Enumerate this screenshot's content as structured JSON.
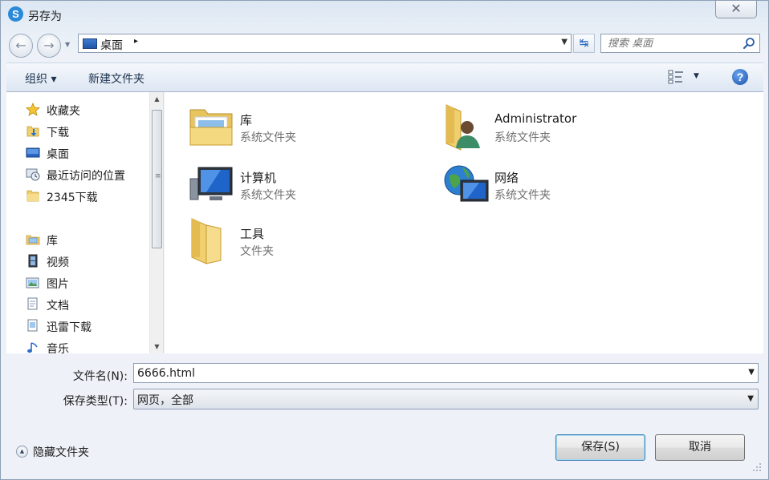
{
  "window": {
    "title": "另存为",
    "close_symbol": "✕"
  },
  "nav": {
    "back_symbol": "←",
    "forward_symbol": "→",
    "address_location": "桌面",
    "address_separator": "▸",
    "refresh_symbol": "↹",
    "search_placeholder": "搜索 桌面"
  },
  "toolbar": {
    "organize_label": "组织 ▾",
    "new_folder_label": "新建文件夹",
    "help_symbol": "?"
  },
  "sidebar": {
    "items": [
      {
        "label": "收藏夹",
        "icon": "star-icon"
      },
      {
        "label": "下载",
        "icon": "downloads-folder-icon"
      },
      {
        "label": "桌面",
        "icon": "desktop-icon"
      },
      {
        "label": "最近访问的位置",
        "icon": "recent-places-icon"
      },
      {
        "label": "2345下载",
        "icon": "folder-icon"
      },
      {
        "label": "库",
        "icon": "library-icon"
      },
      {
        "label": "视频",
        "icon": "videos-icon"
      },
      {
        "label": "图片",
        "icon": "pictures-icon"
      },
      {
        "label": "文档",
        "icon": "documents-icon"
      },
      {
        "label": "迅雷下载",
        "icon": "download-library-icon"
      },
      {
        "label": "音乐",
        "icon": "music-icon"
      }
    ]
  },
  "content": {
    "items": [
      {
        "name": "库",
        "type": "系统文件夹",
        "icon": "library-icon"
      },
      {
        "name": "Administrator",
        "type": "系统文件夹",
        "icon": "user-folder-icon"
      },
      {
        "name": "计算机",
        "type": "系统文件夹",
        "icon": "computer-icon"
      },
      {
        "name": "网络",
        "type": "系统文件夹",
        "icon": "network-icon"
      },
      {
        "name": "工具",
        "type": "文件夹",
        "icon": "folder-icon"
      }
    ]
  },
  "form": {
    "filename_label": "文件名(N):",
    "filename_value": "6666.html",
    "filetype_label": "保存类型(T):",
    "filetype_value": "网页，全部",
    "hide_folders_label": "隐藏文件夹",
    "save_label": "保存(S)",
    "cancel_label": "取消"
  },
  "colors": {
    "chrome_bg": "#eef2f8",
    "accent": "#2b6cc4",
    "folder": "#f2d27a"
  }
}
